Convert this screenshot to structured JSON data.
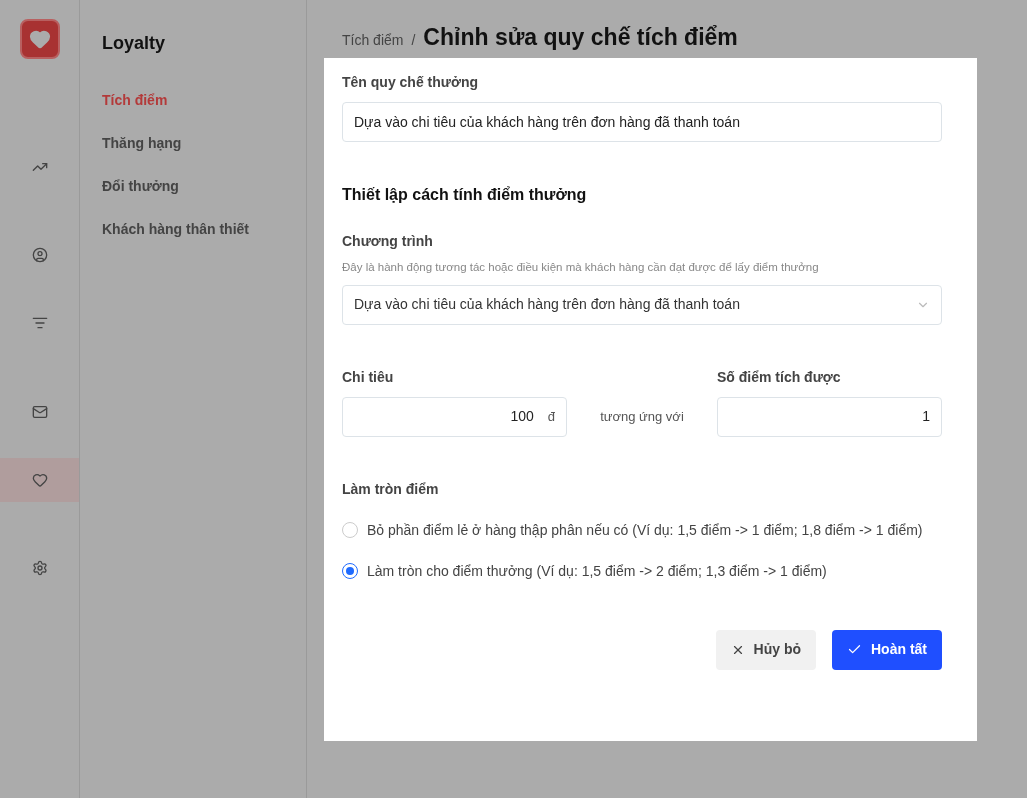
{
  "rail": [
    {
      "kind": "chart",
      "selected": false
    },
    {
      "kind": "user",
      "selected": false
    },
    {
      "kind": "filter",
      "selected": false
    },
    {
      "kind": "mail",
      "selected": false
    },
    {
      "kind": "heart",
      "selected": true
    },
    {
      "kind": "settings",
      "selected": false
    }
  ],
  "subnav": {
    "title": "Loyalty",
    "items": [
      {
        "label": "Tích điểm",
        "selected": true
      },
      {
        "label": "Thăng hạng",
        "selected": false
      },
      {
        "label": "Đổi thưởng",
        "selected": false
      },
      {
        "label": "Khách hàng thân thiết",
        "selected": false
      }
    ]
  },
  "breadcrumb": {
    "parent": "Tích điểm",
    "separator": "/",
    "title": "Chỉnh sửa quy chế tích điểm"
  },
  "form": {
    "name_label": "Tên quy chế thưởng",
    "name_value": "Dựa vào chi tiêu của khách hàng trên đơn hàng đã thanh toán",
    "section_title": "Thiết lập cách tính điểm thưởng",
    "program_label": "Chương trình",
    "program_hint": "Đây là hành động tương tác hoặc điều kiện mà khách hàng cần đạt được để lấy điểm thưởng",
    "program_value": "Dựa vào chi tiêu của khách hàng trên đơn hàng đã thanh toán",
    "spend_label": "Chi tiêu",
    "spend_value": "100",
    "spend_unit": "đ",
    "equals_text": "tương ứng với",
    "points_label": "Số điểm tích được",
    "points_value": "1",
    "rounding_label": "Làm tròn điểm",
    "rounding_options": [
      {
        "label": "Bỏ phần điểm lẻ ở hàng thập phân nếu có (Ví dụ: 1,5 điểm -> 1 điểm; 1,8 điểm -> 1 điểm)",
        "selected": false
      },
      {
        "label": "Làm tròn cho điểm thưởng (Ví dụ: 1,5 điểm -> 2 điểm; 1,3 điểm -> 1 điểm)",
        "selected": true
      }
    ],
    "cancel": "Hủy bỏ",
    "submit": "Hoàn tất"
  }
}
